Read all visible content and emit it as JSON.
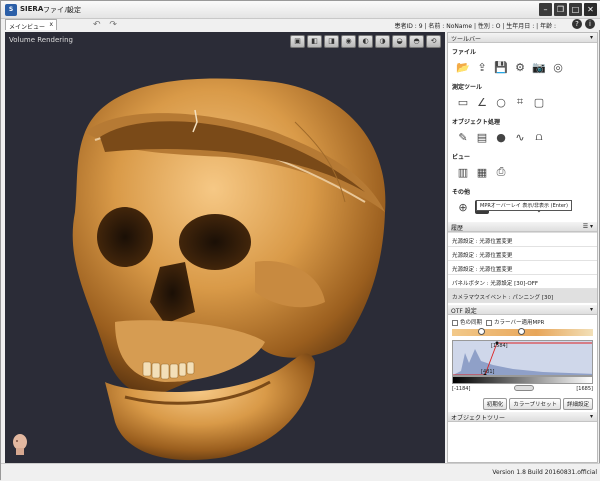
{
  "app": {
    "name": "SIERA",
    "menus": [
      "ファイル",
      "設定"
    ]
  },
  "tab": {
    "label": "メインビュー",
    "close": "x"
  },
  "patient_info": "患者ID : 9 | 名前 : NoName | 性別 : O | 生年月日 : | 年齢 :",
  "viewport": {
    "title": "Volume Rendering"
  },
  "toolbar_panel": {
    "header": "ツールバー",
    "sections": [
      {
        "title": "ファイル",
        "icons": [
          "open-folder",
          "import",
          "save",
          "dicom-export",
          "camera",
          "disc"
        ]
      },
      {
        "title": "測定ツール",
        "icons": [
          "ruler",
          "angle",
          "circle",
          "freehand",
          "annotation"
        ]
      },
      {
        "title": "オブジェクト処理",
        "icons": [
          "pen-edit",
          "segment",
          "mask",
          "curve",
          "tooth"
        ]
      },
      {
        "title": "ビュー",
        "icons": [
          "layout-single",
          "layout-grid",
          "print"
        ]
      },
      {
        "title": "その他",
        "icons": [
          "zoom",
          "mpr-overlay",
          "export",
          "home",
          "bookmark",
          "undo-rotate"
        ]
      }
    ],
    "tooltip": "MPRオーバーレイ 表示/非表示 (Enter)"
  },
  "history": {
    "header": "履歴",
    "items": [
      "光源設定 : 光源位置変更",
      "光源設定 : 光源位置変更",
      "光源設定 : 光源位置変更",
      "パネルボタン : 光源設定 [30]-OFF",
      "カメラマウスイベント : パンニング [30]"
    ]
  },
  "otf": {
    "header": "OTF 設定",
    "check_sync": "色の同期",
    "check_colorbar": "カラーバー適用MPR",
    "value_top": "[1584]",
    "value_bottom": "[481]",
    "range_min": "[-1184]",
    "range_max": "[1685]",
    "btn_init": "初期化",
    "btn_preset": "カラープリセット",
    "btn_detail": "詳細設定"
  },
  "object_tree": {
    "header": "オブジェクトツリー"
  },
  "status": {
    "version": "Version 1.8 Build 20160831.official"
  }
}
